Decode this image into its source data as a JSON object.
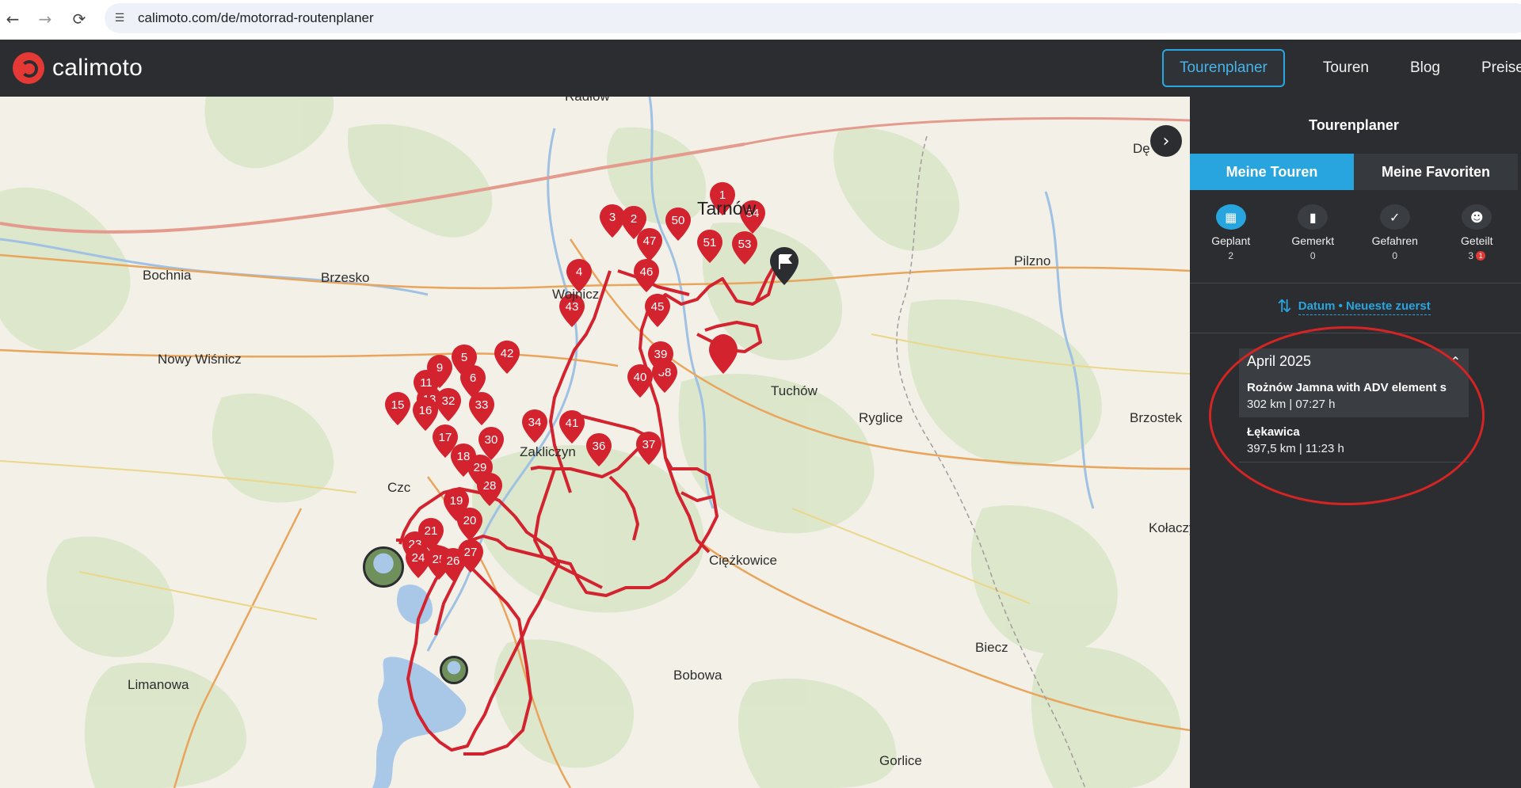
{
  "browser": {
    "back_icon": "arrow-left-icon",
    "forward_icon": "arrow-right-icon",
    "reload_icon": "reload-icon",
    "url": "calimoto.com/de/motorrad-routenplaner"
  },
  "header": {
    "logo_text": "calimoto",
    "nav": {
      "primary": "Tourenplaner",
      "touren": "Touren",
      "blog": "Blog",
      "preise": "Preise"
    }
  },
  "map": {
    "places": {
      "radlow": "Radłów",
      "debica": "Dę",
      "tarnow": "Tarnów",
      "bochnia": "Bochnia",
      "brzesko": "Brzesko",
      "wojnicz": "Wojnicz",
      "pilzno": "Pilzno",
      "nowy_wisnicz": "Nowy Wiśnicz",
      "tuchow": "Tuchów",
      "ryglice": "Ryglice",
      "brzostek": "Brzostek",
      "zakliczyn": "Zakliczyn",
      "czchow": "Czc",
      "kolaczyce": "Kołaczy",
      "ciezkowice": "Ciężkowice",
      "biecz": "Biecz",
      "limanowa": "Limanowa",
      "bobowa": "Bobowa",
      "gorlice": "Gorlice"
    },
    "markers": [
      "1",
      "2",
      "3",
      "4",
      "5",
      "6",
      "9",
      "11",
      "13",
      "15",
      "16",
      "17",
      "18",
      "19",
      "20",
      "21",
      "23",
      "24",
      "25",
      "26",
      "27",
      "28",
      "29",
      "30",
      "32",
      "33",
      "34",
      "36",
      "37",
      "38",
      "39",
      "40",
      "41",
      "42",
      "43",
      "45",
      "46",
      "47",
      "50",
      "51",
      "53",
      "54"
    ],
    "route_color": "#d3232f"
  },
  "sidebar": {
    "title": "Tourenplaner",
    "tabs": {
      "mine": "Meine Touren",
      "favorites": "Meine Favoriten"
    },
    "filters": {
      "planned": {
        "label": "Geplant",
        "count": "2"
      },
      "saved": {
        "label": "Gemerkt",
        "count": "0"
      },
      "ridden": {
        "label": "Gefahren",
        "count": "0"
      },
      "shared": {
        "label": "Geteilt",
        "count": "3",
        "badge": "1"
      }
    },
    "sort_label": "Datum • Neueste zuerst",
    "group": {
      "label": "April 2025",
      "tours": [
        {
          "name": "Rożnów Jamna with ADV element s",
          "meta": "302 km | 07:27 h"
        },
        {
          "name": "Łękawica",
          "meta": "397,5 km | 11:23 h"
        }
      ]
    }
  },
  "colors": {
    "accent": "#28a5df",
    "dark": "#2b2d31",
    "route": "#d3232f",
    "annotation": "#d42424"
  }
}
